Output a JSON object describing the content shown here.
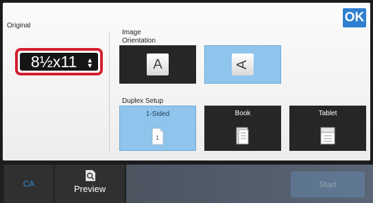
{
  "header": {
    "ok_label": "OK"
  },
  "original": {
    "label": "Original",
    "size_value": "8½x11"
  },
  "orientation": {
    "label_line1": "Image",
    "label_line2": "Orientation",
    "options": [
      "portrait-icon",
      "landscape-icon"
    ]
  },
  "duplex": {
    "label": "Duplex Setup",
    "options": [
      {
        "label": "1-Sided",
        "selected": true,
        "icon": "one-sided-icon"
      },
      {
        "label": "Book",
        "selected": false,
        "icon": "book-icon"
      },
      {
        "label": "Tablet",
        "selected": false,
        "icon": "tablet-icon"
      }
    ]
  },
  "bottom": {
    "ca_label": "CA",
    "preview_label": "Preview",
    "start_label": "Start"
  },
  "colors": {
    "accent": "#2f7fd0",
    "selected_tile": "#8fc4ec",
    "highlight_border": "#d41f2f"
  }
}
